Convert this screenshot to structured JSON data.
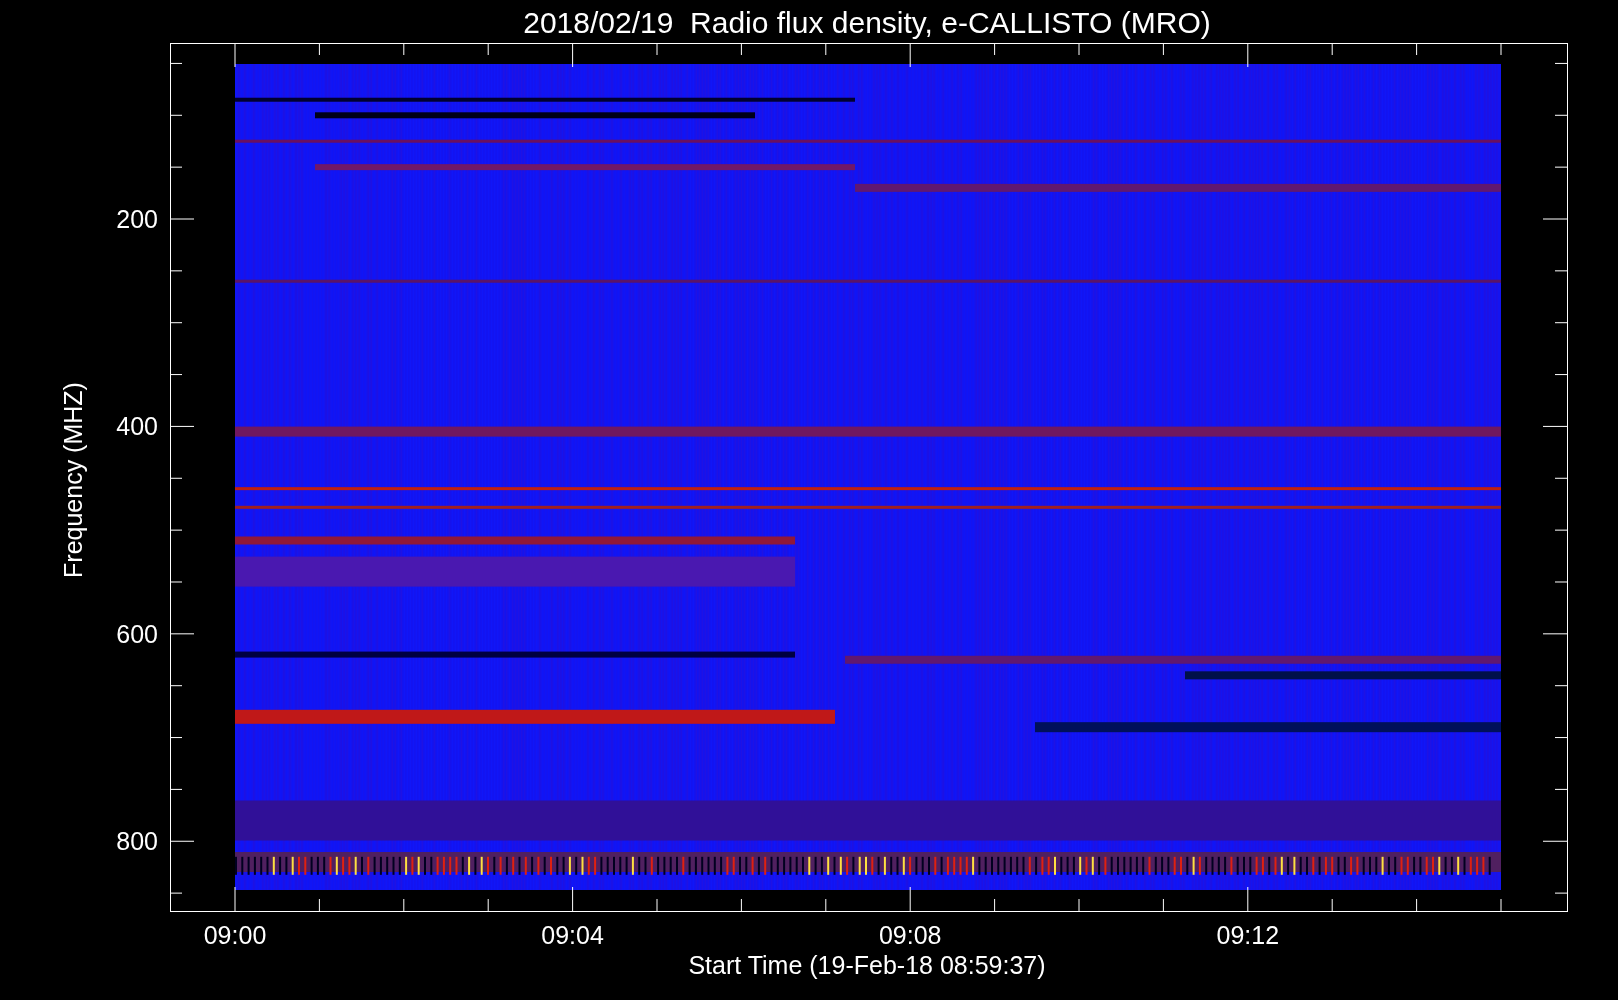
{
  "title": "2018/02/19  Radio flux density, e-CALLISTO (MRO)",
  "y_axis": {
    "label": "Frequency (MHZ)",
    "ticks": [
      "200",
      "400",
      "600",
      "800"
    ]
  },
  "x_axis": {
    "label": "Start Time (19-Feb-18 08:59:37)",
    "ticks": [
      "09:00",
      "09:04",
      "09:08",
      "09:12"
    ]
  }
}
